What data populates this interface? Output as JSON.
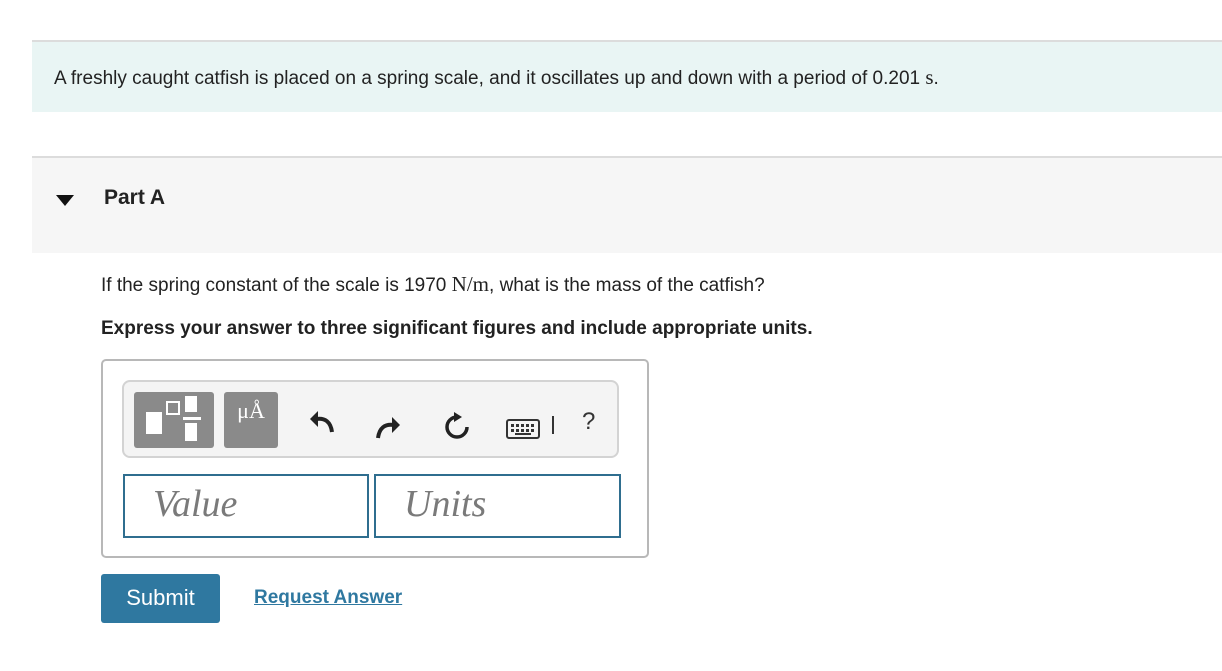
{
  "problem": {
    "intro_text": "A freshly caught catfish is placed on a spring scale, and it oscillates up and down with a period of 0.201",
    "intro_unit": "s",
    "intro_end": "."
  },
  "part": {
    "title": "Part A",
    "question_before": "If the spring constant of the scale is 1970",
    "question_unit": "N/m",
    "question_after": ", what is the mass of the catfish?",
    "instruction": "Express your answer to three significant figures and include appropriate units."
  },
  "toolbar": {
    "units_glyph": "μÅ",
    "help_label": "?"
  },
  "inputs": {
    "value_placeholder": "Value",
    "units_placeholder": "Units"
  },
  "actions": {
    "submit_label": "Submit",
    "request_answer_label": "Request Answer"
  },
  "icons": {
    "part_toggle": "triangle-down-icon",
    "templates": "templates-icon",
    "undo": "undo-icon",
    "redo": "redo-icon",
    "reset": "reset-icon",
    "keyboard": "keyboard-icon"
  },
  "colors": {
    "intro_background": "#e9f5f4",
    "part_background": "#f6f6f6",
    "accent": "#2f78a0",
    "field_border": "#2f6e8f",
    "tool_button": "#8a8a8a"
  }
}
